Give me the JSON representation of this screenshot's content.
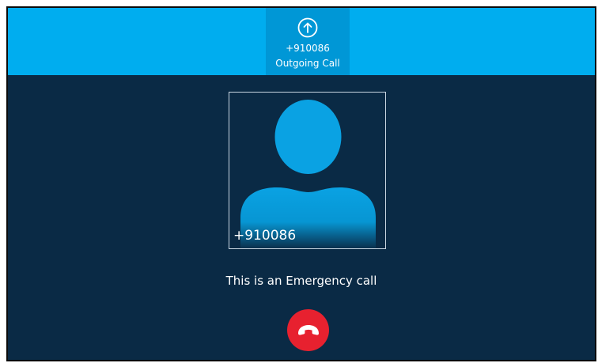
{
  "call": {
    "number": "+910086",
    "status": "Outgoing Call",
    "direction_icon": "outgoing-arrow-icon"
  },
  "avatar": {
    "name": "+910086",
    "icon": "person-silhouette-icon"
  },
  "message": "This is an Emergency call",
  "hangup": {
    "icon": "end-call-icon",
    "color": "#e7212f"
  },
  "colors": {
    "topbar": "#00adef",
    "call_tab": "#0097d6",
    "background": "#0a2a45",
    "silhouette": "#0aa2e3"
  }
}
